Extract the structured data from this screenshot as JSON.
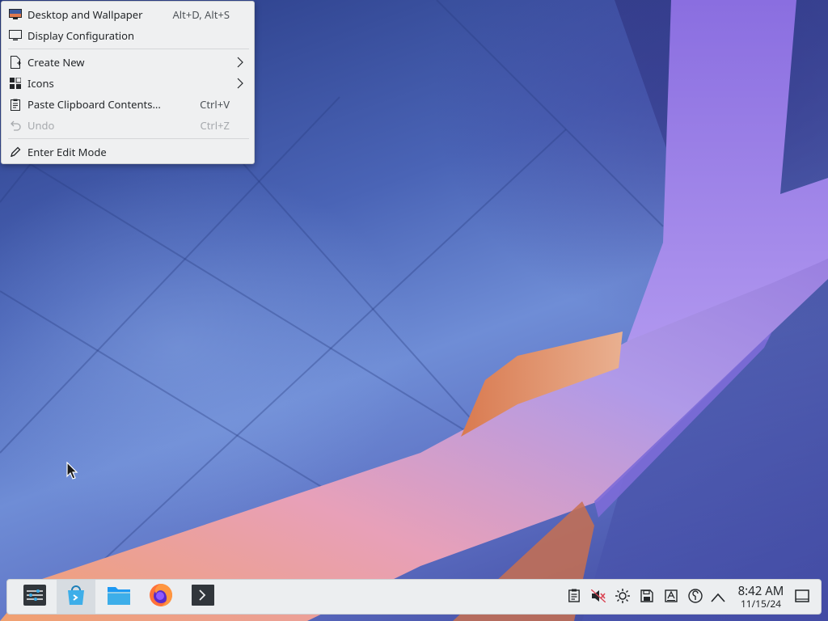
{
  "menu": {
    "items": [
      {
        "label": "Desktop and Wallpaper",
        "shortcut": "Alt+D, Alt+S",
        "icon": "desktop-wallpaper-icon"
      },
      {
        "label": "Display Configuration",
        "shortcut": "",
        "icon": "monitor-icon"
      },
      {
        "label": "Create New",
        "shortcut": "",
        "icon": "new-document-icon",
        "submenu": true
      },
      {
        "label": "Icons",
        "shortcut": "",
        "icon": "icons-grid-icon",
        "submenu": true
      },
      {
        "label": "Paste Clipboard Contents...",
        "shortcut": "Ctrl+V",
        "icon": "clipboard-icon"
      },
      {
        "label": "Undo",
        "shortcut": "Ctrl+Z",
        "icon": "undo-icon",
        "disabled": true
      },
      {
        "label": "Enter Edit Mode",
        "shortcut": "",
        "icon": "pencil-icon"
      }
    ]
  },
  "taskbar": {
    "apps": [
      "application-launcher",
      "discover",
      "dolphin-file-manager",
      "firefox",
      "konsole"
    ],
    "tray": [
      "clipboard-icon",
      "volume-muted-icon",
      "brightness-icon",
      "disk-icon",
      "keyboard-layout-icon",
      "network-icon",
      "expand-tray-icon"
    ],
    "clock": {
      "time": "8:42 AM",
      "date": "11/15/24"
    }
  },
  "colors": {
    "accent": "#3daee9",
    "menu_bg": "#eff0f1",
    "panel_bg": "#eceef0"
  }
}
